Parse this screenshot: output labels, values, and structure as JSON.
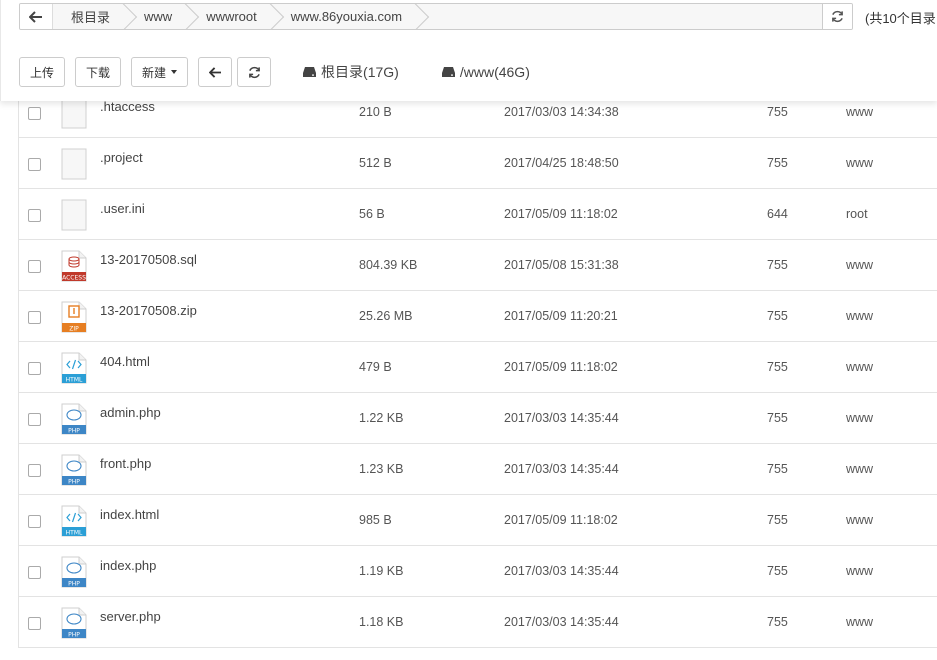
{
  "breadcrumb": [
    "根目录",
    "www",
    "wwwroot",
    "www.86youxia.com"
  ],
  "count_text": "(共10个目录",
  "toolbar": {
    "upload": "上传",
    "download": "下载",
    "new": "新建",
    "disks": [
      "根目录(17G)",
      "/www(46G)"
    ]
  },
  "files": [
    {
      "name": ".htaccess",
      "size": "210 B",
      "mtime": "2017/03/03 14:34:38",
      "perm": "755",
      "owner": "www",
      "icon": "blank"
    },
    {
      "name": ".project",
      "size": "512 B",
      "mtime": "2017/04/25 18:48:50",
      "perm": "755",
      "owner": "www",
      "icon": "blank"
    },
    {
      "name": ".user.ini",
      "size": "56 B",
      "mtime": "2017/05/09 11:18:02",
      "perm": "644",
      "owner": "root",
      "icon": "blank"
    },
    {
      "name": "13-20170508.sql",
      "size": "804.39 KB",
      "mtime": "2017/05/08 15:31:38",
      "perm": "755",
      "owner": "www",
      "icon": "sql"
    },
    {
      "name": "13-20170508.zip",
      "size": "25.26 MB",
      "mtime": "2017/05/09 11:20:21",
      "perm": "755",
      "owner": "www",
      "icon": "zip"
    },
    {
      "name": "404.html",
      "size": "479 B",
      "mtime": "2017/05/09 11:18:02",
      "perm": "755",
      "owner": "www",
      "icon": "html"
    },
    {
      "name": "admin.php",
      "size": "1.22 KB",
      "mtime": "2017/03/03 14:35:44",
      "perm": "755",
      "owner": "www",
      "icon": "php"
    },
    {
      "name": "front.php",
      "size": "1.23 KB",
      "mtime": "2017/03/03 14:35:44",
      "perm": "755",
      "owner": "www",
      "icon": "php"
    },
    {
      "name": "index.html",
      "size": "985 B",
      "mtime": "2017/05/09 11:18:02",
      "perm": "755",
      "owner": "www",
      "icon": "html"
    },
    {
      "name": "index.php",
      "size": "1.19 KB",
      "mtime": "2017/03/03 14:35:44",
      "perm": "755",
      "owner": "www",
      "icon": "php"
    },
    {
      "name": "server.php",
      "size": "1.18 KB",
      "mtime": "2017/03/03 14:35:44",
      "perm": "755",
      "owner": "www",
      "icon": "php"
    }
  ],
  "icon_labels": {
    "sql": "ACCESS",
    "zip": "ZIP",
    "html": "HTML",
    "php": "PHP"
  },
  "colors": {
    "sql": "#c0392b",
    "zip": "#e67e22",
    "html": "#2b9fd6",
    "php": "#3d86c6"
  }
}
